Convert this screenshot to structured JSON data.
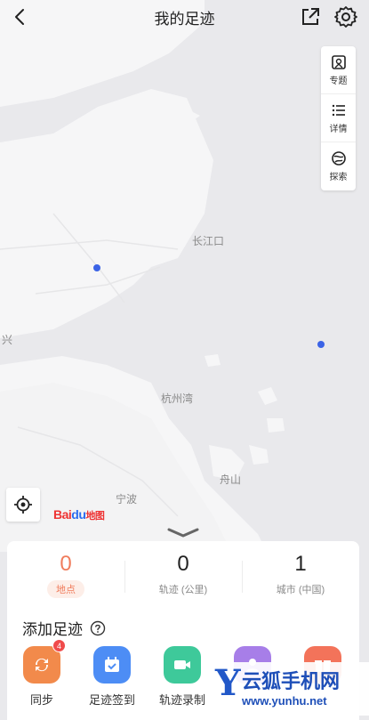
{
  "header": {
    "title": "我的足迹"
  },
  "tools": [
    {
      "label": "专题",
      "icon": "topic-icon"
    },
    {
      "label": "详情",
      "icon": "list-icon"
    },
    {
      "label": "探索",
      "icon": "explore-icon"
    }
  ],
  "map_labels": {
    "yangtze": "长江口",
    "hangzhou_bay": "杭州湾",
    "ningbo": "宁波",
    "zhoushan": "舟山",
    "xing": "兴"
  },
  "logo": {
    "bai": "Bai",
    "du": "du",
    "map": "地图"
  },
  "stats": [
    {
      "value": "0",
      "caption": "地点"
    },
    {
      "value": "0",
      "caption": "轨迹 (公里)"
    },
    {
      "value": "1",
      "caption": "城市 (中国)"
    }
  ],
  "add_section": {
    "title": "添加足迹"
  },
  "actions": [
    {
      "label": "同步",
      "badge": "4",
      "color": "#f28a4b"
    },
    {
      "label": "足迹签到",
      "color": "#4d8df5"
    },
    {
      "label": "轨迹录制",
      "color": "#3ec99a"
    },
    {
      "label": "",
      "color": "#a77ee8"
    },
    {
      "label": "",
      "color": "#f3735a"
    }
  ],
  "watermark": {
    "letter": "Y",
    "text": "云狐手机网",
    "url": "www.yunhu.net"
  },
  "colors": {
    "accent": "#f07c5c",
    "marker": "#3b63e6"
  }
}
